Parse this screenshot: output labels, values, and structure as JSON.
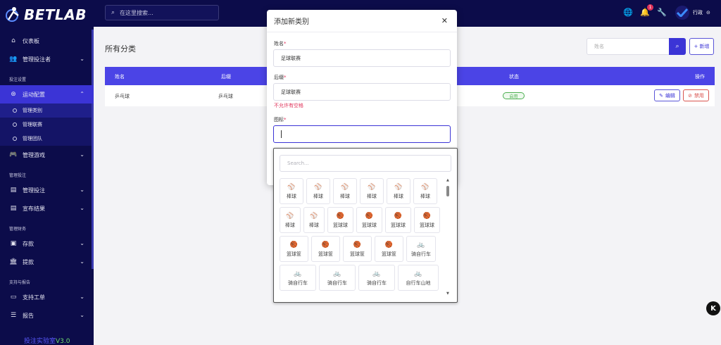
{
  "brand": {
    "name": "BETLAB"
  },
  "sidebar": {
    "items": [
      {
        "label": "仪表板",
        "icon": "home-icon"
      },
      {
        "label": "管理投注者",
        "icon": "users-icon"
      }
    ],
    "section_bet_settings": "投注设置",
    "sports": {
      "label": "运动配置",
      "icon": "sports-icon"
    },
    "sports_sub": [
      "管理类别",
      "管理联赛",
      "管理团队"
    ],
    "games": {
      "label": "管理游戏",
      "icon": "gamepad-icon"
    },
    "section_manage_bets": "管理投注",
    "bets": {
      "label": "管理投注",
      "icon": "clipboard-icon"
    },
    "results": {
      "label": "宣布结果",
      "icon": "clipboard-icon"
    },
    "section_finance": "管理财务",
    "deposit": {
      "label": "存款",
      "icon": "deposit-icon"
    },
    "withdraw": {
      "label": "提款",
      "icon": "bank-icon"
    },
    "section_support": "支持与报告",
    "tickets": {
      "label": "支持工单",
      "icon": "ticket-icon"
    },
    "reports": {
      "label": "报告",
      "icon": "list-icon"
    },
    "version_prefix": "投注实验室",
    "version_num": "V3.0"
  },
  "topbar": {
    "search_placeholder": "在这里搜索...",
    "notification_count": "1",
    "username": "行政"
  },
  "page": {
    "title": "所有分类",
    "name_search_placeholder": "姓名",
    "add_label": "+ 新增"
  },
  "table": {
    "headers": {
      "name": "姓名",
      "slug": "后缀",
      "status": "状态",
      "action": "操作"
    },
    "rows": [
      {
        "name": "乒乓球",
        "slug": "乒乓球",
        "status": "启用",
        "edit": "编辑",
        "disable": "禁用"
      }
    ]
  },
  "modal": {
    "title": "添加新类别",
    "name_label": "姓名",
    "name_value": "足球联赛",
    "slug_label": "后缀",
    "slug_value": "足球联赛",
    "slug_error": "不允许有空格",
    "icon_label": "图标",
    "required_mark": "*",
    "icon_value": ""
  },
  "icon_picker": {
    "search_placeholder": "Search...",
    "rows": [
      [
        {
          "glyph": "⚾",
          "label": "棒球"
        },
        {
          "glyph": "⚾",
          "label": "棒球"
        },
        {
          "glyph": "⚾",
          "label": "棒球"
        },
        {
          "glyph": "⚾",
          "label": "棒球"
        },
        {
          "glyph": "⚾",
          "label": "棒球"
        },
        {
          "glyph": "⚾",
          "label": "棒球"
        }
      ],
      [
        {
          "glyph": "⚾",
          "label": "棒球"
        },
        {
          "glyph": "⚾",
          "label": "棒球"
        },
        {
          "glyph": "🏀",
          "label": "篮球球"
        },
        {
          "glyph": "🏀",
          "label": "篮球球"
        },
        {
          "glyph": "🏀",
          "label": "篮球球"
        },
        {
          "glyph": "🏀",
          "label": "篮球球"
        }
      ],
      [
        {
          "glyph": "🏀",
          "label": "篮球筐"
        },
        {
          "glyph": "🏀",
          "label": "篮球筐"
        },
        {
          "glyph": "🏀",
          "label": "篮球筐"
        },
        {
          "glyph": "🏀",
          "label": "篮球筐"
        },
        {
          "glyph": "🚲",
          "label": "骑自行车"
        }
      ],
      [
        {
          "glyph": "🚲",
          "label": "骑自行车"
        },
        {
          "glyph": "🚲",
          "label": "骑自行车"
        },
        {
          "glyph": "🚲",
          "label": "骑自行车"
        },
        {
          "glyph": "🚲",
          "label": "自行车山地"
        }
      ]
    ]
  },
  "colors": {
    "sidebar_bg": "#0c0c4a",
    "accent": "#3b34d6",
    "table_head": "#4b44e6",
    "danger": "#d9534f",
    "success": "#4caf50"
  }
}
